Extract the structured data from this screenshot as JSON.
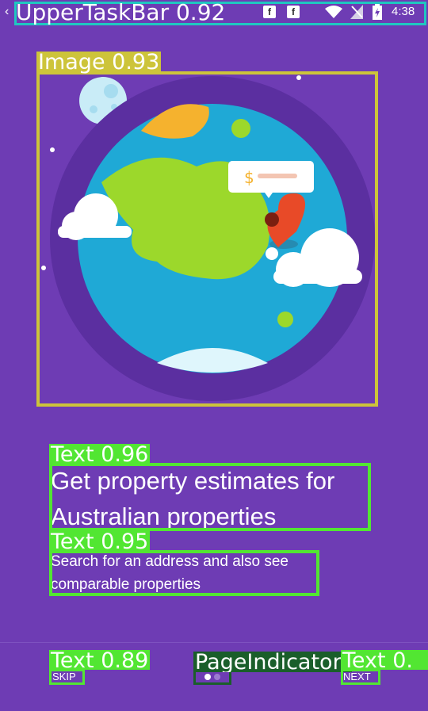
{
  "status_bar": {
    "time": "4:38",
    "notification_labels": [
      "f",
      "f"
    ],
    "icons": [
      "back-arrow-icon",
      "facebook-notification-icon",
      "facebook-notification-icon",
      "wifi-icon",
      "no-signal-icon",
      "battery-icon"
    ]
  },
  "illustration": {
    "price_bubble_symbol": "$"
  },
  "onboarding": {
    "title": "Get property estimates for\nAustralian properties",
    "subtitle": "Search for an address and also see\ncomparable properties",
    "skip_label": "SKIP",
    "next_label": "NEXT",
    "page_index": 1,
    "page_count": 3
  },
  "annotations": [
    {
      "label": "UpperTaskBar 0.92",
      "color": "#1fc8c0"
    },
    {
      "label": "Image 0.93",
      "color": "#cdc43a"
    },
    {
      "label": "Text 0.96",
      "color": "#52e632"
    },
    {
      "label": "Text 0.95",
      "color": "#52e632"
    },
    {
      "label": "Text 0.89",
      "color": "#52e632"
    },
    {
      "label": "PageIndicator",
      "color": "#1a5e2a"
    },
    {
      "label": "Text 0.",
      "color": "#52e632"
    }
  ],
  "colors": {
    "background": "#6e3cb4",
    "planet_ring": "#5b2fa0",
    "ocean": "#1fa9d6",
    "land": "#9cd82b",
    "pin": "#e84a28"
  }
}
